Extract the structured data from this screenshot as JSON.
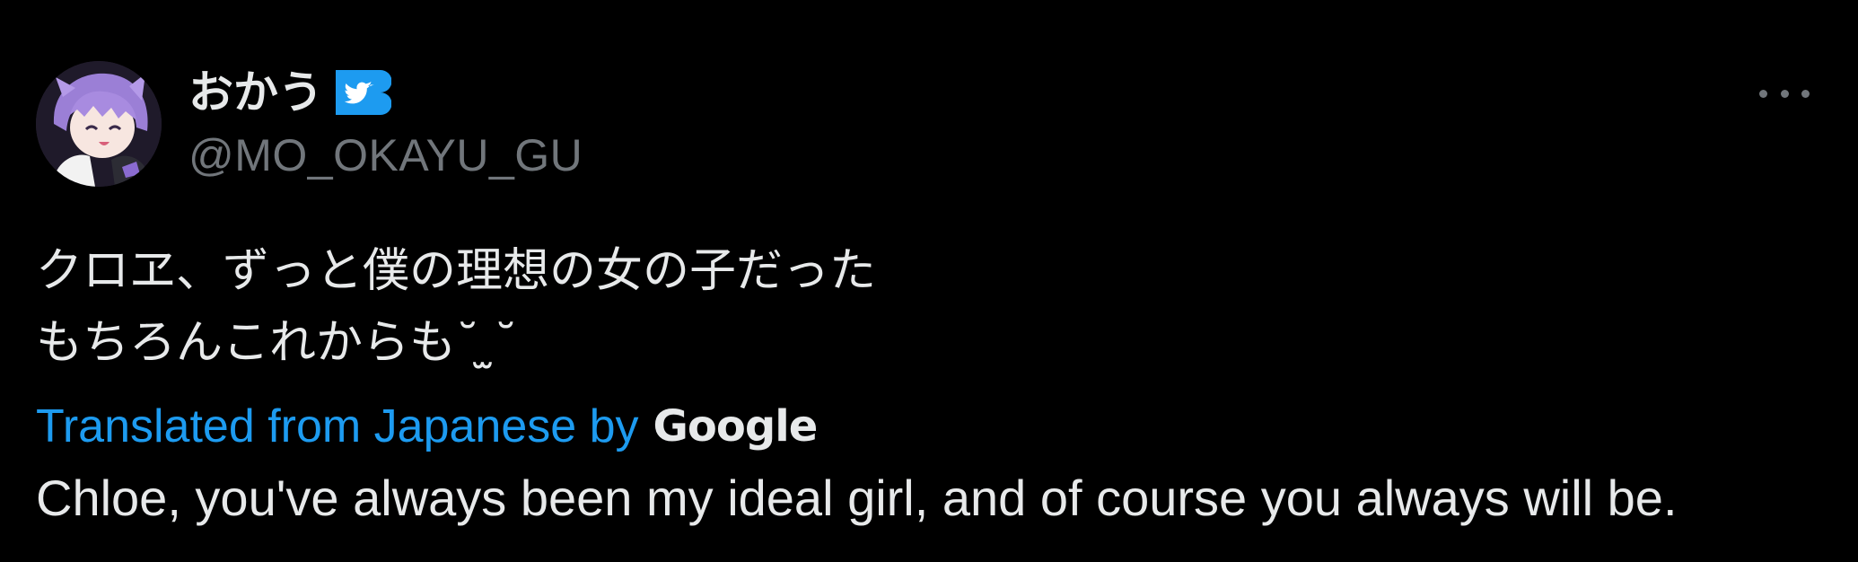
{
  "author": {
    "display_name": "おかう",
    "handle": "@MO_OKAYU_GU",
    "avatar_icon": "avatar-anime-character",
    "badge_icon": "bird-badge-icon"
  },
  "tweet": {
    "text": "クロヱ、ずっと僕の理想の女の子だった\nもちろんこれからも˘ ̫˘",
    "translated_label": "Translated from Japanese by",
    "translator_brand": "Google",
    "translation": "Chloe, you've always been my ideal girl, and of course you always will be."
  },
  "actions": {
    "more_icon": "more-horizontal-icon"
  },
  "colors": {
    "background": "#000000",
    "text_primary": "#e7e9ea",
    "text_secondary": "#71767b",
    "accent": "#1d9bf0"
  }
}
